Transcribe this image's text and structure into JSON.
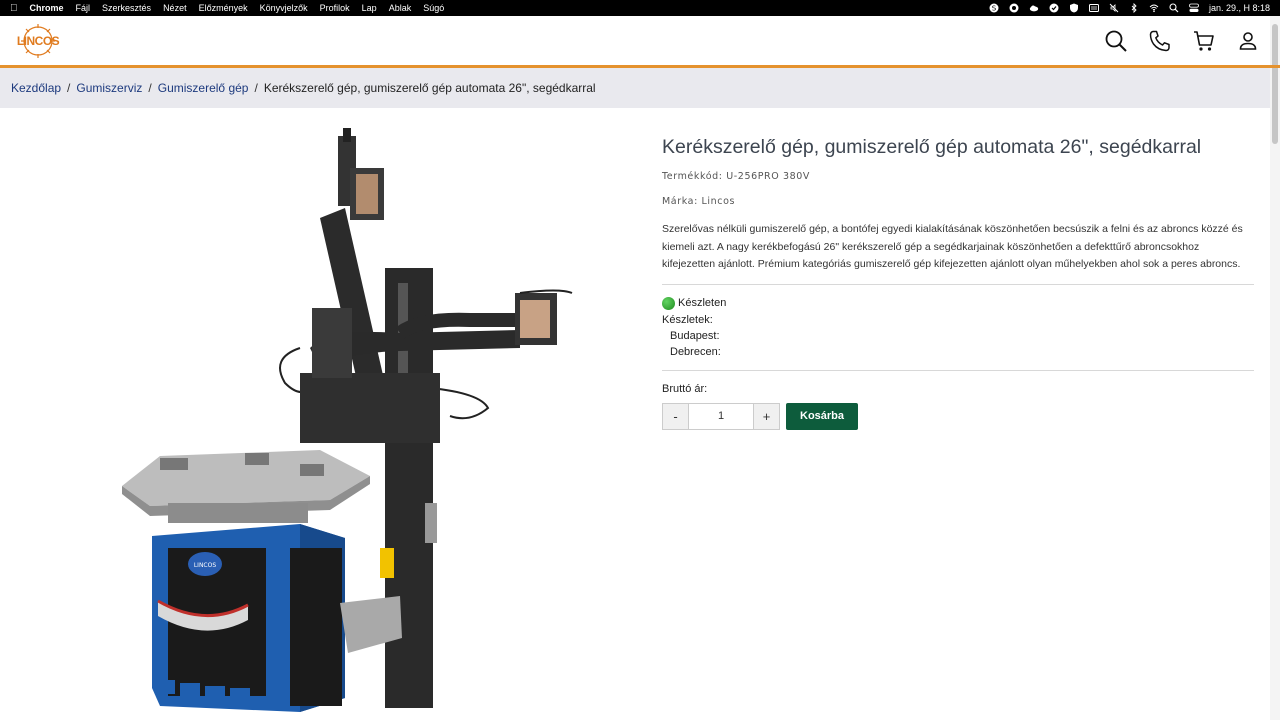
{
  "menubar": {
    "app": "Chrome",
    "items": [
      "Fájl",
      "Szerkesztés",
      "Nézet",
      "Előzmények",
      "Könyvjelzők",
      "Profilok",
      "Lap",
      "Ablak",
      "Súgó"
    ],
    "clock": "jan. 29., H  8:18"
  },
  "header": {
    "logo_text": "LINCOS",
    "icons": [
      "search-icon",
      "phone-icon",
      "cart-icon",
      "user-icon"
    ]
  },
  "breadcrumb": {
    "items": [
      "Kezdőlap",
      "Gumiszerviz",
      "Gumiszerelő gép"
    ],
    "current": "Kerékszerelő gép, gumiszerelő gép automata 26\", segédkarral"
  },
  "product": {
    "title": "Kerékszerelő gép, gumiszerelő gép automata 26\", segédkarral",
    "code_label": "Termékkód:",
    "code": "U-256PRO 380V",
    "brand_label": "Márka:",
    "brand": "Lincos",
    "description": "Szerelővas nélküli gumiszerelő gép, a bontófej egyedi kialakításának köszönhetően becsúszik a felni és az abroncs közzé és kiemeli azt. A nagy kerékbefogású 26\" kerékszerelő gép a segédkarjainak köszönhetően a defekttűrő abroncsokhoz kifejezetten ajánlott. Prémium kategóriás gumiszerelő gép kifejezetten ajánlott olyan műhelyekben ahol sok a peres abroncs.",
    "stock_status": "Készleten",
    "stocks_label": "Készletek:",
    "locations": [
      "Budapest:",
      "Debrecen:"
    ],
    "price_label": "Bruttó ár:",
    "quantity": "1",
    "minus": "-",
    "plus": "+",
    "cart_button": "Kosárba"
  },
  "colors": {
    "accent_orange": "#e5922e",
    "cart_green": "#0d5c3c",
    "link_blue": "#1d3a7e",
    "machine_blue": "#1f5fb0"
  }
}
